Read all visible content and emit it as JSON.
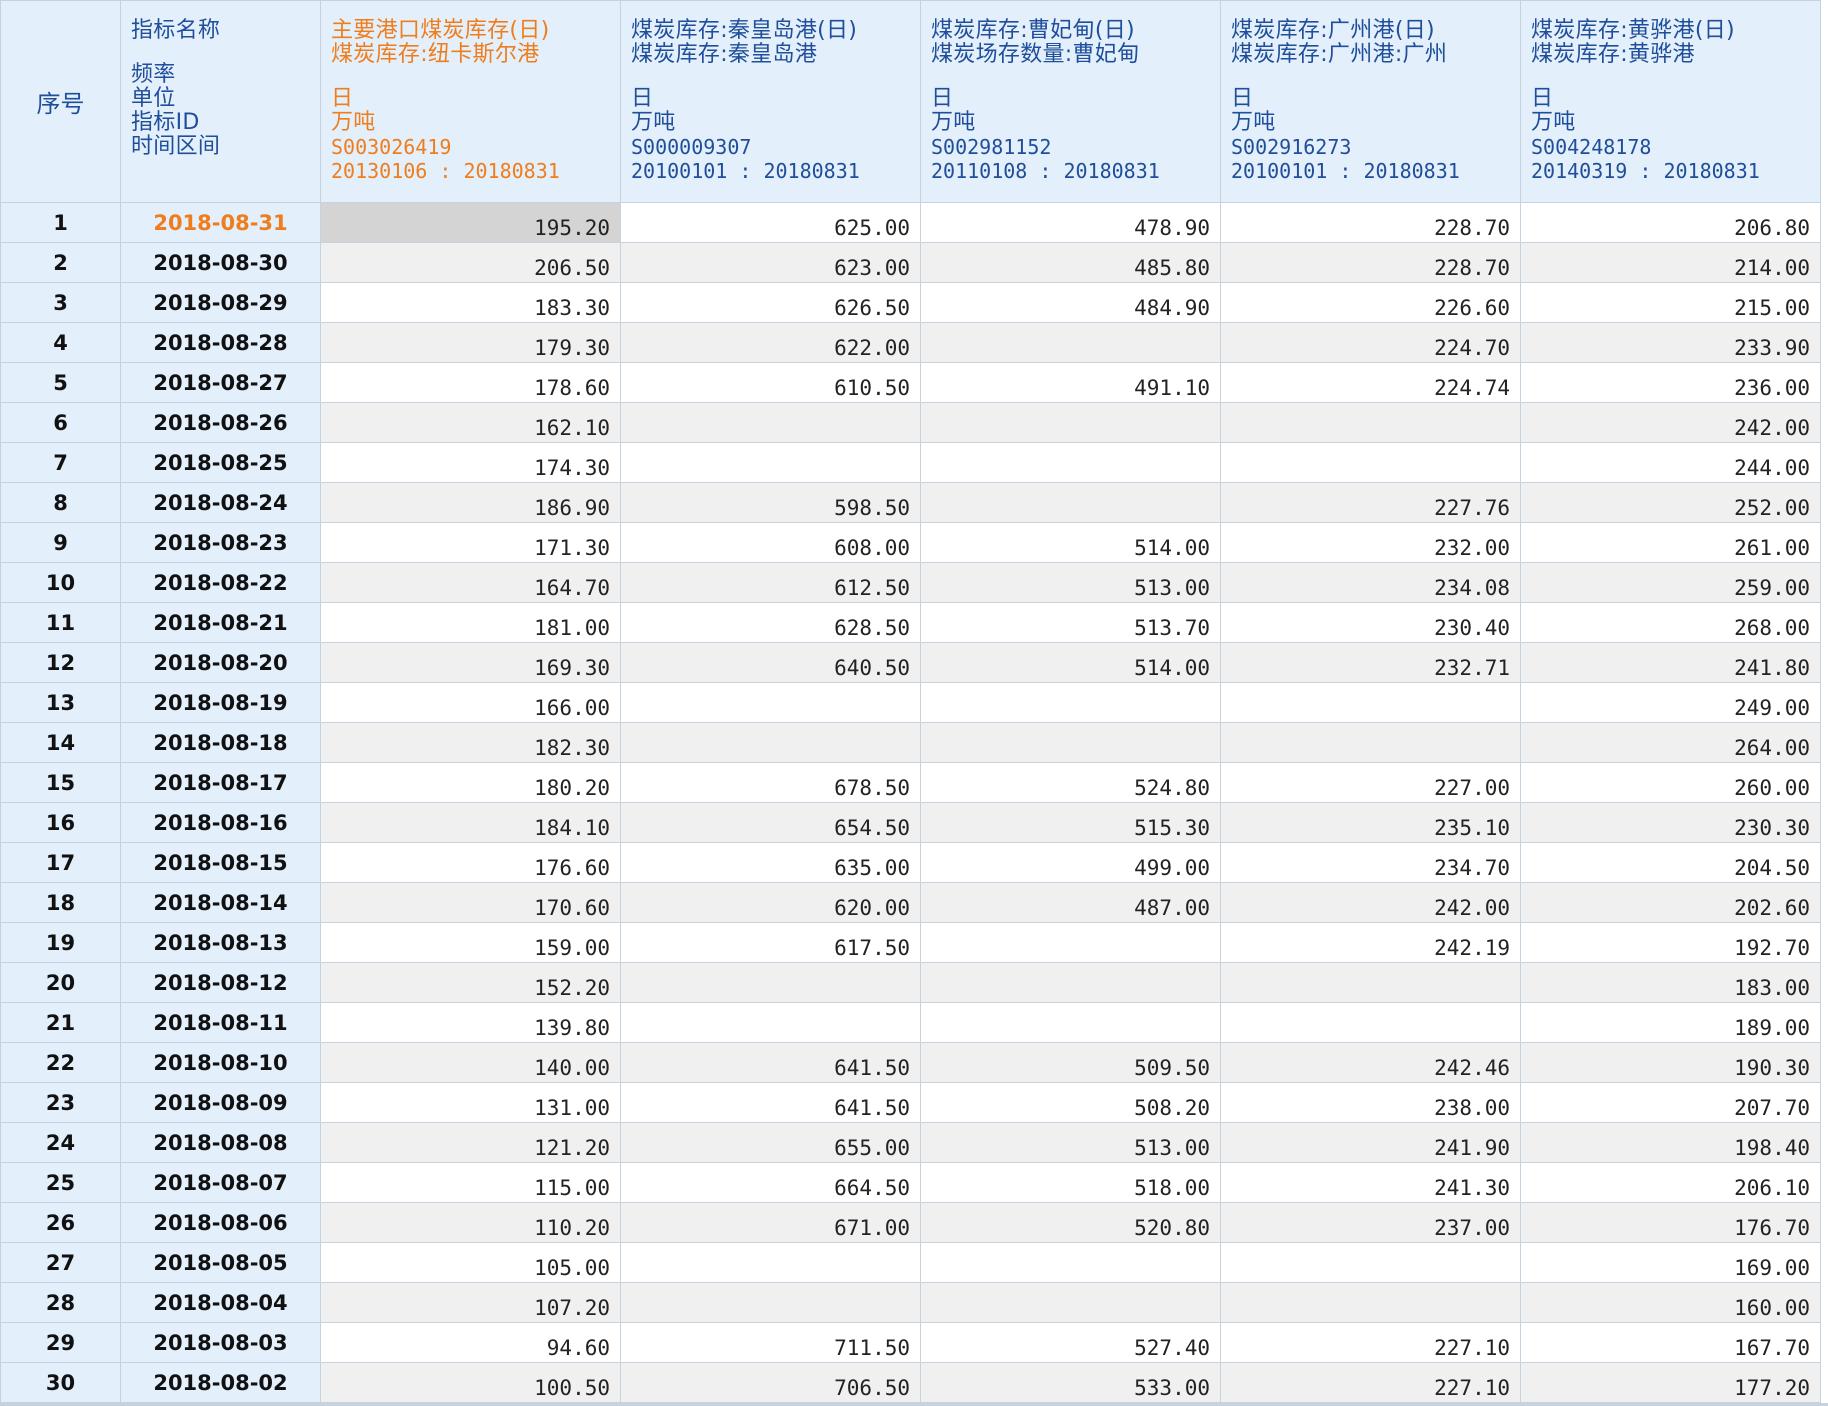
{
  "header": {
    "seq_label": "序号",
    "meta": [
      "指标名称",
      "",
      "频率",
      "单位",
      "指标ID",
      "时间区间"
    ],
    "columns": [
      {
        "name1": "主要港口煤炭库存(日)",
        "name2": "煤炭库存:纽卡斯尔港",
        "freq": "日",
        "unit": "万吨",
        "id": "S003026419",
        "range": "20130106 : 20180831",
        "active": true
      },
      {
        "name1": "煤炭库存:秦皇岛港(日)",
        "name2": "煤炭库存:秦皇岛港",
        "freq": "日",
        "unit": "万吨",
        "id": "S000009307",
        "range": "20100101 : 20180831",
        "active": false
      },
      {
        "name1": "煤炭库存:曹妃甸(日)",
        "name2": "煤炭场存数量:曹妃甸",
        "freq": "日",
        "unit": "万吨",
        "id": "S002981152",
        "range": "20110108 : 20180831",
        "active": false
      },
      {
        "name1": "煤炭库存:广州港(日)",
        "name2": "煤炭库存:广州港:广州",
        "freq": "日",
        "unit": "万吨",
        "id": "S002916273",
        "range": "20100101 : 20180831",
        "active": false
      },
      {
        "name1": "煤炭库存:黄骅港(日)",
        "name2": "煤炭库存:黄骅港",
        "freq": "日",
        "unit": "万吨",
        "id": "S004248178",
        "range": "20140319 : 20180831",
        "active": false
      }
    ]
  },
  "rows": [
    {
      "seq": "1",
      "date": "2018-08-31",
      "values": [
        "195.20",
        "625.00",
        "478.90",
        "228.70",
        "206.80"
      ]
    },
    {
      "seq": "2",
      "date": "2018-08-30",
      "values": [
        "206.50",
        "623.00",
        "485.80",
        "228.70",
        "214.00"
      ]
    },
    {
      "seq": "3",
      "date": "2018-08-29",
      "values": [
        "183.30",
        "626.50",
        "484.90",
        "226.60",
        "215.00"
      ]
    },
    {
      "seq": "4",
      "date": "2018-08-28",
      "values": [
        "179.30",
        "622.00",
        "",
        "224.70",
        "233.90"
      ]
    },
    {
      "seq": "5",
      "date": "2018-08-27",
      "values": [
        "178.60",
        "610.50",
        "491.10",
        "224.74",
        "236.00"
      ]
    },
    {
      "seq": "6",
      "date": "2018-08-26",
      "values": [
        "162.10",
        "",
        "",
        "",
        "242.00"
      ]
    },
    {
      "seq": "7",
      "date": "2018-08-25",
      "values": [
        "174.30",
        "",
        "",
        "",
        "244.00"
      ]
    },
    {
      "seq": "8",
      "date": "2018-08-24",
      "values": [
        "186.90",
        "598.50",
        "",
        "227.76",
        "252.00"
      ]
    },
    {
      "seq": "9",
      "date": "2018-08-23",
      "values": [
        "171.30",
        "608.00",
        "514.00",
        "232.00",
        "261.00"
      ]
    },
    {
      "seq": "10",
      "date": "2018-08-22",
      "values": [
        "164.70",
        "612.50",
        "513.00",
        "234.08",
        "259.00"
      ]
    },
    {
      "seq": "11",
      "date": "2018-08-21",
      "values": [
        "181.00",
        "628.50",
        "513.70",
        "230.40",
        "268.00"
      ]
    },
    {
      "seq": "12",
      "date": "2018-08-20",
      "values": [
        "169.30",
        "640.50",
        "514.00",
        "232.71",
        "241.80"
      ]
    },
    {
      "seq": "13",
      "date": "2018-08-19",
      "values": [
        "166.00",
        "",
        "",
        "",
        "249.00"
      ]
    },
    {
      "seq": "14",
      "date": "2018-08-18",
      "values": [
        "182.30",
        "",
        "",
        "",
        "264.00"
      ]
    },
    {
      "seq": "15",
      "date": "2018-08-17",
      "values": [
        "180.20",
        "678.50",
        "524.80",
        "227.00",
        "260.00"
      ]
    },
    {
      "seq": "16",
      "date": "2018-08-16",
      "values": [
        "184.10",
        "654.50",
        "515.30",
        "235.10",
        "230.30"
      ]
    },
    {
      "seq": "17",
      "date": "2018-08-15",
      "values": [
        "176.60",
        "635.00",
        "499.00",
        "234.70",
        "204.50"
      ]
    },
    {
      "seq": "18",
      "date": "2018-08-14",
      "values": [
        "170.60",
        "620.00",
        "487.00",
        "242.00",
        "202.60"
      ]
    },
    {
      "seq": "19",
      "date": "2018-08-13",
      "values": [
        "159.00",
        "617.50",
        "",
        "242.19",
        "192.70"
      ]
    },
    {
      "seq": "20",
      "date": "2018-08-12",
      "values": [
        "152.20",
        "",
        "",
        "",
        "183.00"
      ]
    },
    {
      "seq": "21",
      "date": "2018-08-11",
      "values": [
        "139.80",
        "",
        "",
        "",
        "189.00"
      ]
    },
    {
      "seq": "22",
      "date": "2018-08-10",
      "values": [
        "140.00",
        "641.50",
        "509.50",
        "242.46",
        "190.30"
      ]
    },
    {
      "seq": "23",
      "date": "2018-08-09",
      "values": [
        "131.00",
        "641.50",
        "508.20",
        "238.00",
        "207.70"
      ]
    },
    {
      "seq": "24",
      "date": "2018-08-08",
      "values": [
        "121.20",
        "655.00",
        "513.00",
        "241.90",
        "198.40"
      ]
    },
    {
      "seq": "25",
      "date": "2018-08-07",
      "values": [
        "115.00",
        "664.50",
        "518.00",
        "241.30",
        "206.10"
      ]
    },
    {
      "seq": "26",
      "date": "2018-08-06",
      "values": [
        "110.20",
        "671.00",
        "520.80",
        "237.00",
        "176.70"
      ]
    },
    {
      "seq": "27",
      "date": "2018-08-05",
      "values": [
        "105.00",
        "",
        "",
        "",
        "169.00"
      ]
    },
    {
      "seq": "28",
      "date": "2018-08-04",
      "values": [
        "107.20",
        "",
        "",
        "",
        "160.00"
      ]
    },
    {
      "seq": "29",
      "date": "2018-08-03",
      "values": [
        "94.60",
        "711.50",
        "527.40",
        "227.10",
        "167.70"
      ]
    },
    {
      "seq": "30",
      "date": "2018-08-02",
      "values": [
        "100.50",
        "706.50",
        "533.00",
        "227.10",
        "177.20"
      ]
    }
  ],
  "selection": {
    "row": 0,
    "col": 0
  },
  "colors": {
    "accent": "#f07d1c",
    "header_text": "#1f4e9b",
    "header_bg": "#e3effb",
    "grid": "#c7d2df"
  }
}
